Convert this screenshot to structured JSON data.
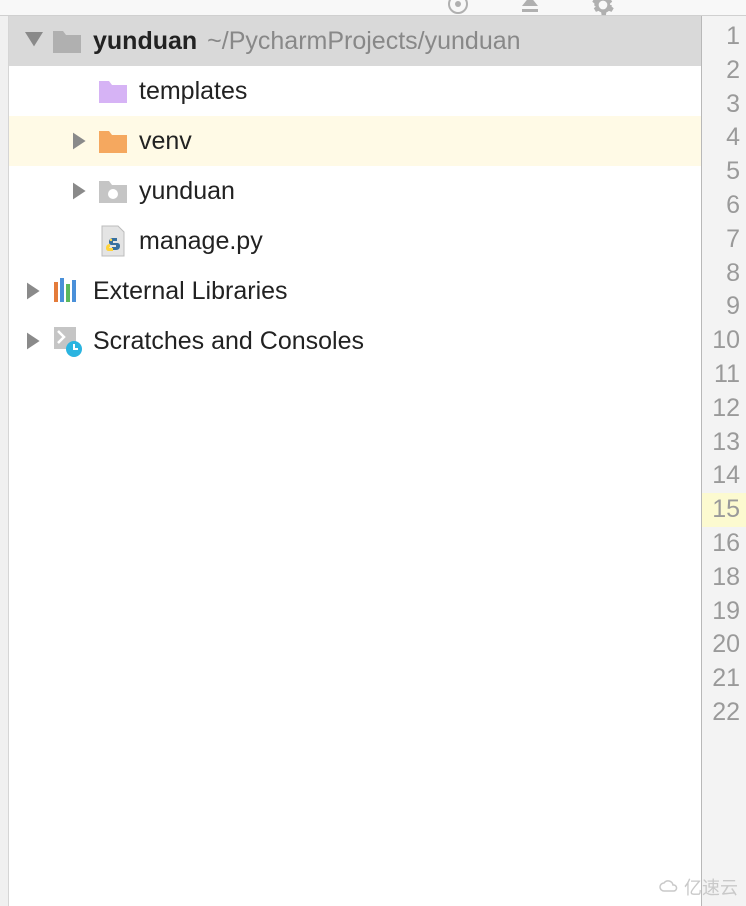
{
  "toolbar": {
    "icon1": "target-icon",
    "icon2": "collapse-icon",
    "icon3": "gear-icon"
  },
  "tree": {
    "root": {
      "name": "yunduan",
      "path": "~/PycharmProjects/yunduan"
    },
    "items": [
      {
        "label": "templates"
      },
      {
        "label": "venv"
      },
      {
        "label": "yunduan"
      },
      {
        "label": "manage.py"
      }
    ],
    "external": "External Libraries",
    "scratches": "Scratches and Consoles"
  },
  "gutter": {
    "lines": [
      "1",
      "2",
      "3",
      "4",
      "5",
      "6",
      "7",
      "8",
      "9",
      "10",
      "11",
      "12",
      "13",
      "14",
      "15",
      "16",
      "18",
      "19",
      "20",
      "21",
      "22"
    ],
    "highlighted_line": "15"
  },
  "watermark": "亿速云"
}
